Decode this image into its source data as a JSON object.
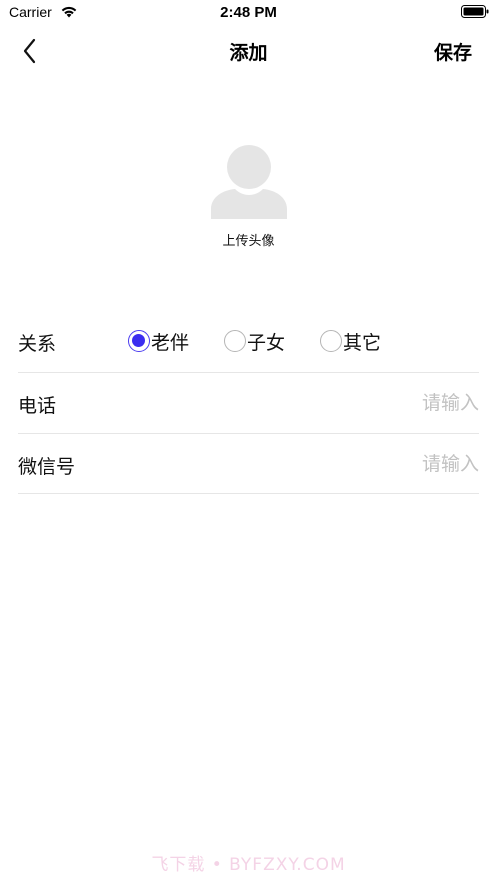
{
  "status_bar": {
    "carrier": "Carrier",
    "time": "2:48 PM",
    "icons": [
      "wifi-icon",
      "battery-icon"
    ]
  },
  "nav": {
    "back_icon": "chevron-left-icon",
    "title": "添加",
    "save_label": "保存"
  },
  "avatar": {
    "icon": "person-silhouette-icon",
    "upload_label": "上传头像"
  },
  "form": {
    "relation": {
      "label": "关系",
      "options": [
        "老伴",
        "子女",
        "其它"
      ],
      "selected": "老伴"
    },
    "phone": {
      "label": "电话",
      "placeholder": "请输入",
      "value": ""
    },
    "wechat": {
      "label": "微信号",
      "placeholder": "请输入",
      "value": ""
    }
  },
  "watermark": "飞下载 • BYFZXY.COM",
  "colors": {
    "accent": "#3b2df0",
    "placeholder": "#c2c2c2",
    "divider": "#e6e6e6",
    "avatar": "#e5e5e5"
  }
}
